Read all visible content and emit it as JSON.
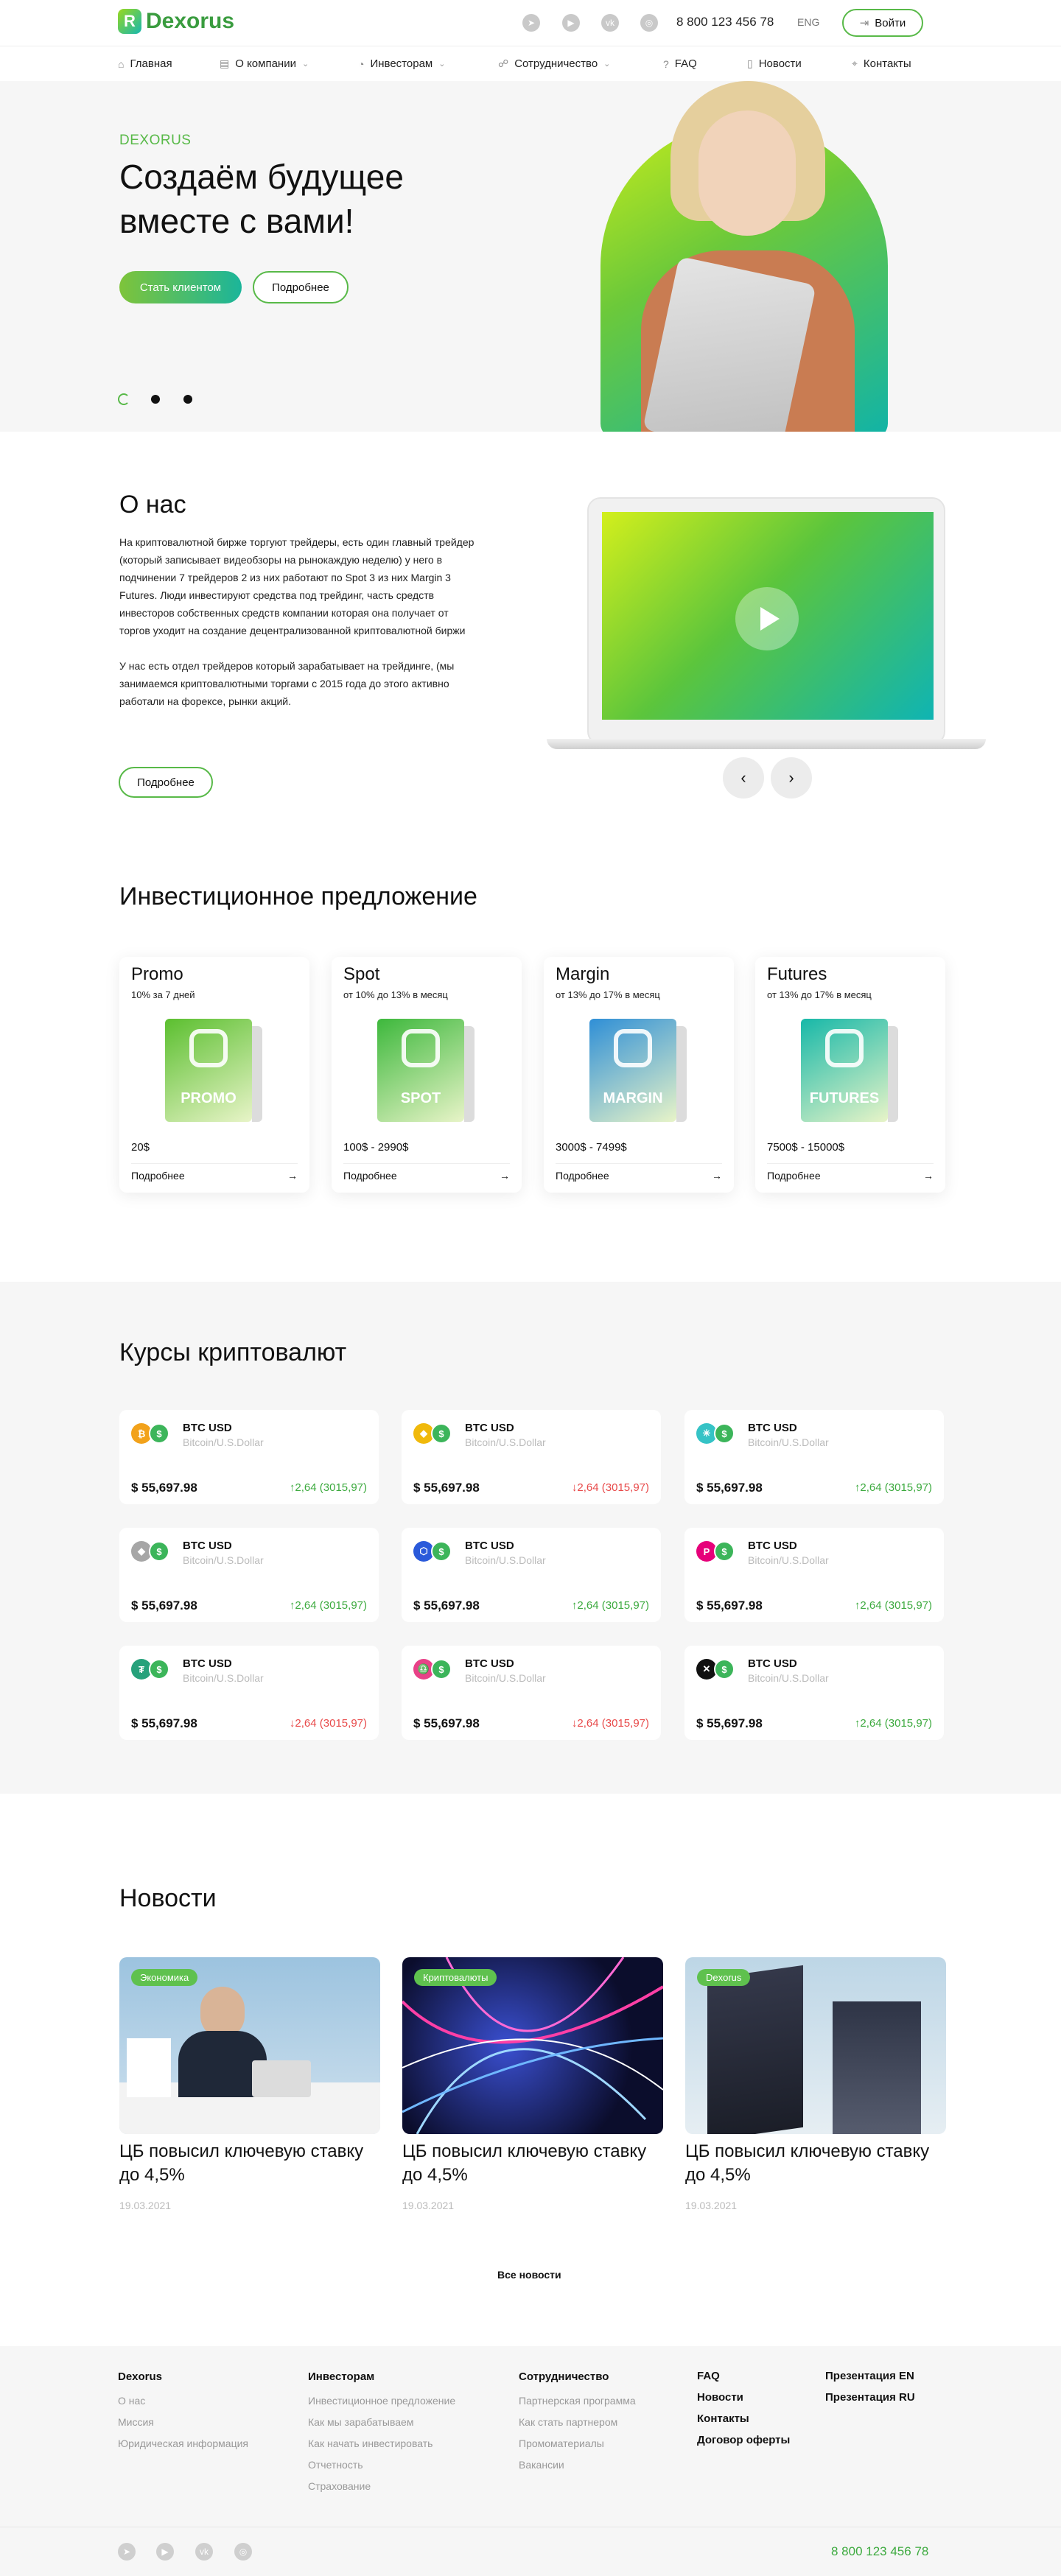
{
  "header": {
    "brand": "Dexorus",
    "phone": "8 800 123 456 78",
    "lang": "ENG",
    "login_label": "Войти",
    "socials": [
      "telegram-icon",
      "youtube-icon",
      "vk-icon",
      "instagram-icon"
    ]
  },
  "nav": {
    "items": [
      {
        "label": "Главная",
        "icon": "home-icon"
      },
      {
        "label": "О компании",
        "icon": "building-icon"
      },
      {
        "label": "Инвесторам",
        "icon": "chart-icon"
      },
      {
        "label": "Сотрудничество",
        "icon": "handshake-icon"
      },
      {
        "label": "FAQ",
        "icon": "question-icon"
      },
      {
        "label": "Новости",
        "icon": "document-icon"
      },
      {
        "label": "Контакты",
        "icon": "pin-icon"
      }
    ]
  },
  "hero": {
    "kicker": "DEXORUS",
    "title": "Создаём будущее вместе с вами!",
    "primary_btn": "Стать клиентом",
    "secondary_btn": "Подробнее",
    "slides": 3,
    "active_slide": 1
  },
  "about": {
    "title": "О нас",
    "p1": "На криптовалютной бирже торгуют трейдеры, есть один главный трейдер (который записывает видеобзоры на рынокаждую неделю) у него в подчинении 7 трейдеров 2 из них работают по Spot 3 из них Margin 3 Futures. Люди инвестируют средства под трейдинг, часть средств инвесторов собственных средств компании которая она получает от торгов уходит на создание децентрализованной криптовалютной биржи",
    "p2": "У нас есть отдел трейдеров который зарабатывает на трейдинге, (мы занимаемся криптовалютными торгами с 2015 года до этого активно работали на форексе, рынки акций.",
    "more_btn": "Подробнее"
  },
  "invest": {
    "title": "Инвестиционное предложение",
    "cards": [
      {
        "name": "Promo",
        "sub": "10% за 7 дней",
        "box": "PROMO",
        "price": "20$",
        "more": "Подробнее",
        "color": "#5bbf2f"
      },
      {
        "name": "Spot",
        "sub": "от 10% до 13% в месяц",
        "box": "SPOT",
        "price": "100$ - 2990$",
        "more": "Подробнее",
        "color": "#3db83c"
      },
      {
        "name": "Margin",
        "sub": "от 13% до 17% в месяц",
        "box": "MARGIN",
        "price": "3000$ - 7499$",
        "more": "Подробнее",
        "color": "#2f8fd6"
      },
      {
        "name": "Futures",
        "sub": "от 13% до 17% в месяц",
        "box": "FUTURES",
        "price": "7500$ - 15000$",
        "more": "Подробнее",
        "color": "#17b8a8"
      }
    ]
  },
  "crypto": {
    "title": "Курсы криптовалют",
    "items": [
      {
        "pair": "BTC USD",
        "desc": "Bitcoin/U.S.Dollar",
        "value": "$ 55,697.98",
        "change": "↑2,64 (3015,97)",
        "up": true,
        "coin_color": "#f2a21b",
        "coin_glyph": "₿"
      },
      {
        "pair": "BTC USD",
        "desc": "Bitcoin/U.S.Dollar",
        "value": "$ 55,697.98",
        "change": "↓2,64 (3015,97)",
        "up": false,
        "coin_color": "#f0b90b",
        "coin_glyph": "◆"
      },
      {
        "pair": "BTC USD",
        "desc": "Bitcoin/U.S.Dollar",
        "value": "$ 55,697.98",
        "change": "↑2,64 (3015,97)",
        "up": true,
        "coin_color": "#35c3c6",
        "coin_glyph": "✳"
      },
      {
        "pair": "BTC USD",
        "desc": "Bitcoin/U.S.Dollar",
        "value": "$ 55,697.98",
        "change": "↑2,64 (3015,97)",
        "up": true,
        "coin_color": "#a6a6a6",
        "coin_glyph": "◆"
      },
      {
        "pair": "BTC USD",
        "desc": "Bitcoin/U.S.Dollar",
        "value": "$ 55,697.98",
        "change": "↑2,64 (3015,97)",
        "up": true,
        "coin_color": "#2a5ada",
        "coin_glyph": "⬡"
      },
      {
        "pair": "BTC USD",
        "desc": "Bitcoin/U.S.Dollar",
        "value": "$ 55,697.98",
        "change": "↑2,64 (3015,97)",
        "up": true,
        "coin_color": "#e6007a",
        "coin_glyph": "P"
      },
      {
        "pair": "BTC USD",
        "desc": "Bitcoin/U.S.Dollar",
        "value": "$ 55,697.98",
        "change": "↓2,64 (3015,97)",
        "up": false,
        "coin_color": "#26a17b",
        "coin_glyph": "₮"
      },
      {
        "pair": "BTC USD",
        "desc": "Bitcoin/U.S.Dollar",
        "value": "$ 55,697.98",
        "change": "↓2,64 (3015,97)",
        "up": false,
        "coin_color": "#e84188",
        "coin_glyph": "♎"
      },
      {
        "pair": "BTC USD",
        "desc": "Bitcoin/U.S.Dollar",
        "value": "$ 55,697.98",
        "change": "↑2,64 (3015,97)",
        "up": true,
        "coin_color": "#111111",
        "coin_glyph": "✕"
      }
    ],
    "up_color": "#3daa3f",
    "down_color": "#e84a4a",
    "usd_color": "#3cb55a"
  },
  "news": {
    "title": "Новости",
    "items": [
      {
        "badge": "Экономика",
        "title": "ЦБ повысил ключевую ставку до 4,5%",
        "date": "19.03.2021"
      },
      {
        "badge": "Криптовалюты",
        "title": "ЦБ повысил ключевую ставку до 4,5%",
        "date": "19.03.2021"
      },
      {
        "badge": "Dexorus",
        "title": "ЦБ повысил ключевую ставку до 4,5%",
        "date": "19.03.2021"
      }
    ],
    "all_link": "Все новости"
  },
  "footer": {
    "col1": {
      "head": "Dexorus",
      "links": [
        "О нас",
        "Миссия",
        "Юридическая информация"
      ]
    },
    "col2": {
      "head": "Инвесторам",
      "links": [
        "Инвестиционное предложение",
        "Как мы зарабатываем",
        "Как начать инвестировать",
        "Отчетность",
        "Страхование"
      ]
    },
    "col3": {
      "head": "Сотрудничество",
      "links": [
        "Партнерская программа",
        "Как стать партнером",
        "Промоматериалы",
        "Вакансии"
      ]
    },
    "col4": [
      "FAQ",
      "Новости",
      "Контакты",
      "Договор оферты"
    ],
    "col5": [
      "Презентация EN",
      "Презентация RU"
    ],
    "phone": "8 800 123 456 78"
  }
}
